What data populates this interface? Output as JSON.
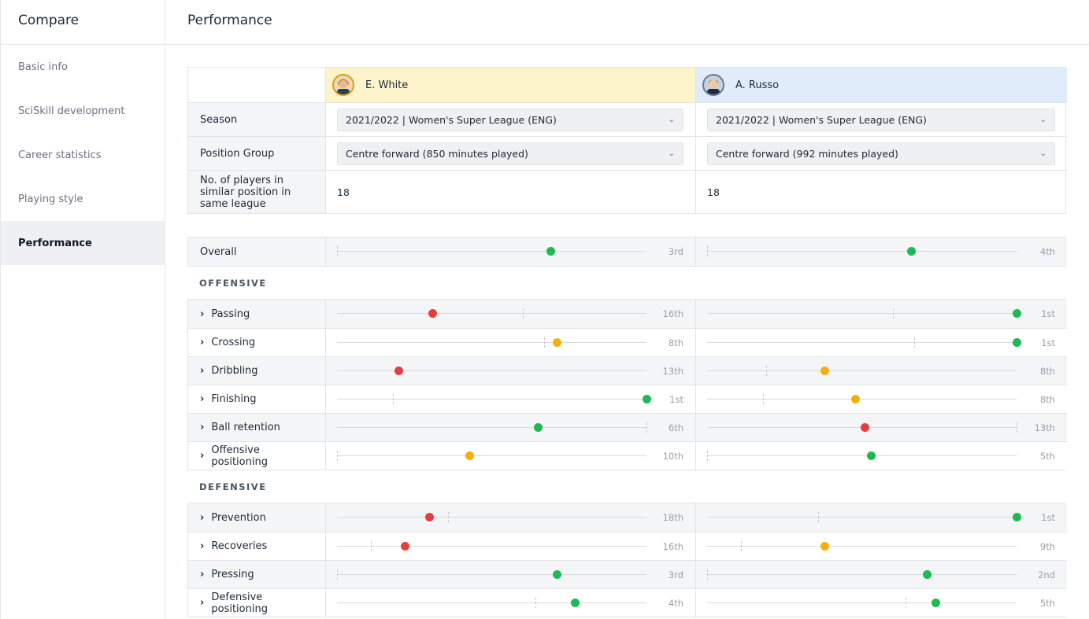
{
  "sidebar": {
    "title": "Compare",
    "items": [
      {
        "label": "Basic info",
        "active": false
      },
      {
        "label": "SciSkill development",
        "active": false
      },
      {
        "label": "Career statistics",
        "active": false
      },
      {
        "label": "Playing style",
        "active": false
      },
      {
        "label": "Performance",
        "active": true
      }
    ]
  },
  "header": {
    "title": "Performance"
  },
  "players": [
    {
      "name": "E. White",
      "highlight_color": "#fdf4cc",
      "avatar_icon": "player-avatar-icon"
    },
    {
      "name": "A. Russo",
      "highlight_color": "#e1ecfb",
      "avatar_icon": "player-avatar-icon"
    }
  ],
  "selectors": {
    "season_label": "Season",
    "season_values": [
      "2021/2022 | Women's Super League (ENG)",
      "2021/2022 | Women's Super League (ENG)"
    ],
    "position_label": "Position Group",
    "position_values": [
      "Centre forward (850 minutes played)",
      "Centre forward (992 minutes played)"
    ],
    "count_label": "No. of players in similar position in same league",
    "count_values": [
      "18",
      "18"
    ]
  },
  "status_colors": {
    "good": "#1eb854",
    "average": "#f2b10a",
    "poor": "#e63e3e"
  },
  "overall": {
    "label": "Overall",
    "players": [
      {
        "value": 0.69,
        "ref": 0.0,
        "status": "good",
        "rank": "3rd"
      },
      {
        "value": 0.66,
        "ref": 0.0,
        "status": "good",
        "rank": "4th"
      }
    ]
  },
  "offensive": {
    "title": "OFFENSIVE",
    "metrics": [
      {
        "label": "Passing",
        "players": [
          {
            "value": 0.31,
            "ref": 0.6,
            "status": "poor",
            "rank": "16th"
          },
          {
            "value": 1.0,
            "ref": 0.6,
            "status": "good",
            "rank": "1st"
          }
        ]
      },
      {
        "label": "Crossing",
        "players": [
          {
            "value": 0.71,
            "ref": 0.67,
            "status": "average",
            "rank": "8th"
          },
          {
            "value": 1.0,
            "ref": 0.67,
            "status": "good",
            "rank": "1st"
          }
        ]
      },
      {
        "label": "Dribbling",
        "players": [
          {
            "value": 0.2,
            "ref": null,
            "status": "poor",
            "rank": "13th"
          },
          {
            "value": 0.38,
            "ref": 0.19,
            "status": "average",
            "rank": "8th"
          }
        ]
      },
      {
        "label": "Finishing",
        "players": [
          {
            "value": 1.0,
            "ref": 0.18,
            "status": "good",
            "rank": "1st"
          },
          {
            "value": 0.48,
            "ref": 0.18,
            "status": "average",
            "rank": "8th"
          }
        ]
      },
      {
        "label": "Ball retention",
        "players": [
          {
            "value": 0.65,
            "ref": 1.0,
            "status": "good",
            "rank": "6th"
          },
          {
            "value": 0.51,
            "ref": 1.0,
            "status": "poor",
            "rank": "13th"
          }
        ]
      },
      {
        "label": "Offensive positioning",
        "players": [
          {
            "value": 0.43,
            "ref": 0.0,
            "status": "average",
            "rank": "10th"
          },
          {
            "value": 0.53,
            "ref": 0.0,
            "status": "good",
            "rank": "5th"
          }
        ]
      }
    ]
  },
  "defensive": {
    "title": "DEFENSIVE",
    "metrics": [
      {
        "label": "Prevention",
        "players": [
          {
            "value": 0.3,
            "ref": 0.36,
            "status": "poor",
            "rank": "18th"
          },
          {
            "value": 1.0,
            "ref": 0.36,
            "status": "good",
            "rank": "1st"
          }
        ]
      },
      {
        "label": "Recoveries",
        "players": [
          {
            "value": 0.22,
            "ref": 0.11,
            "status": "poor",
            "rank": "16th"
          },
          {
            "value": 0.38,
            "ref": 0.11,
            "status": "average",
            "rank": "9th"
          }
        ]
      },
      {
        "label": "Pressing",
        "players": [
          {
            "value": 0.71,
            "ref": 0.0,
            "status": "good",
            "rank": "3rd"
          },
          {
            "value": 0.71,
            "ref": 0.0,
            "status": "good",
            "rank": "2nd"
          }
        ]
      },
      {
        "label": "Defensive positioning",
        "players": [
          {
            "value": 0.77,
            "ref": 0.64,
            "status": "good",
            "rank": "4th"
          },
          {
            "value": 0.74,
            "ref": 0.64,
            "status": "good",
            "rank": "5th"
          }
        ]
      }
    ]
  }
}
